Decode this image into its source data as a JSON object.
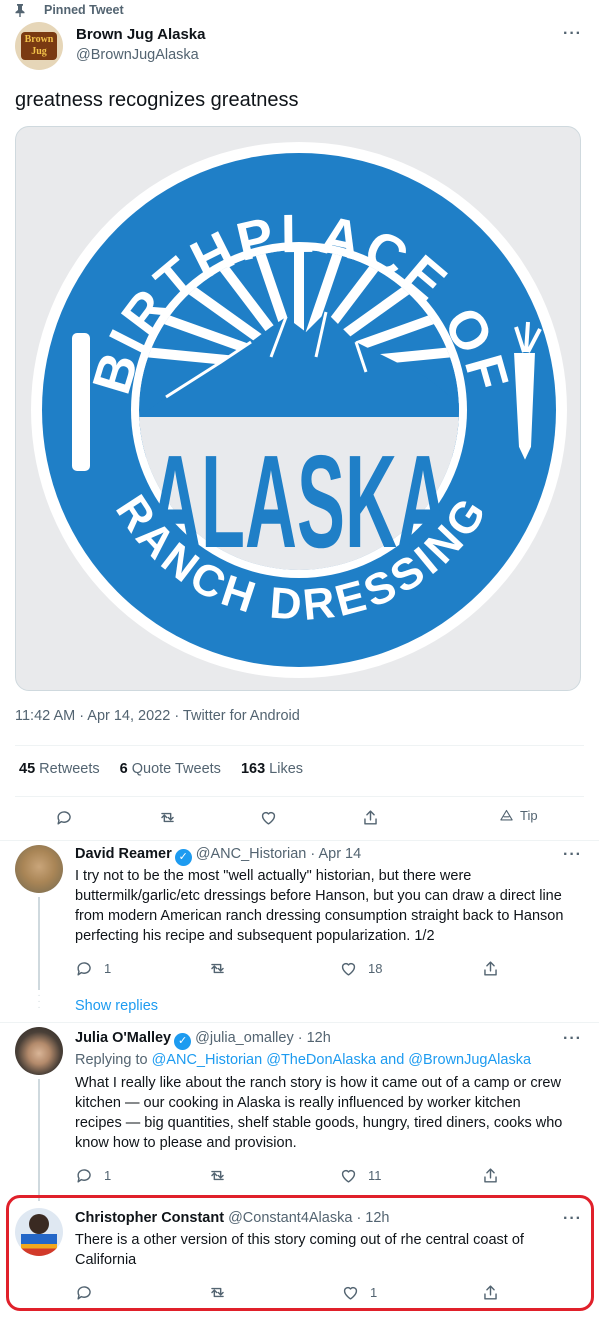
{
  "pinned": {
    "label": "Pinned Tweet"
  },
  "main": {
    "name": "Brown Jug Alaska",
    "handle": "@BrownJugAlaska",
    "text": "greatness recognizes greatness",
    "logo_text": "Brown Jug",
    "image": {
      "top_arc": "BIRTHPLACE OF",
      "center": "ALASKA",
      "bottom_arc": "RANCH DRESSING",
      "colors": {
        "blue": "#1f7fc7",
        "white": "#ffffff",
        "sky": "#e8eaed"
      }
    },
    "meta": "11:42 AM · Apr 14, 2022 · Twitter for Android",
    "stats": {
      "retweets_count": "45",
      "retweets_label": "Retweets",
      "quotes_count": "6",
      "quotes_label": "Quote Tweets",
      "likes_count": "163",
      "likes_label": "Likes"
    },
    "tip_label": "Tip"
  },
  "replies": [
    {
      "name": "David Reamer",
      "verified": true,
      "handle": "@ANC_Historian",
      "time": "· Apr 14",
      "text": "I try not to be the most \"well actually\" historian, but there were buttermilk/garlic/etc dressings before Hanson, but you can draw a direct line from modern American ranch dressing consumption straight back to Hanson perfecting his recipe and subsequent popularization. 1/2",
      "reply_count": "1",
      "retweet_count": "",
      "like_count": "18",
      "show_replies": "Show replies"
    },
    {
      "name": "Julia O'Malley",
      "verified": true,
      "handle": "@julia_omalley",
      "time": "· 12h",
      "replying_prefix": "Replying to",
      "replying_to": "@ANC_Historian @TheDonAlaska and @BrownJugAlaska",
      "text": "What I really like about the ranch story is how it came out of a camp or crew kitchen — our cooking in Alaska is really influenced by worker kitchen recipes — big quantities, shelf stable goods, hungry, tired diners, cooks who know how to please and provision.",
      "reply_count": "1",
      "retweet_count": "",
      "like_count": "11"
    },
    {
      "name": "Christopher Constant",
      "handle": "@Constant4Alaska",
      "time": "· 12h",
      "text": "There is a other version of this story coming out of rhe central coast of California",
      "reply_count": "",
      "retweet_count": "",
      "like_count": "1"
    }
  ],
  "highlight_color": "#e0202a"
}
